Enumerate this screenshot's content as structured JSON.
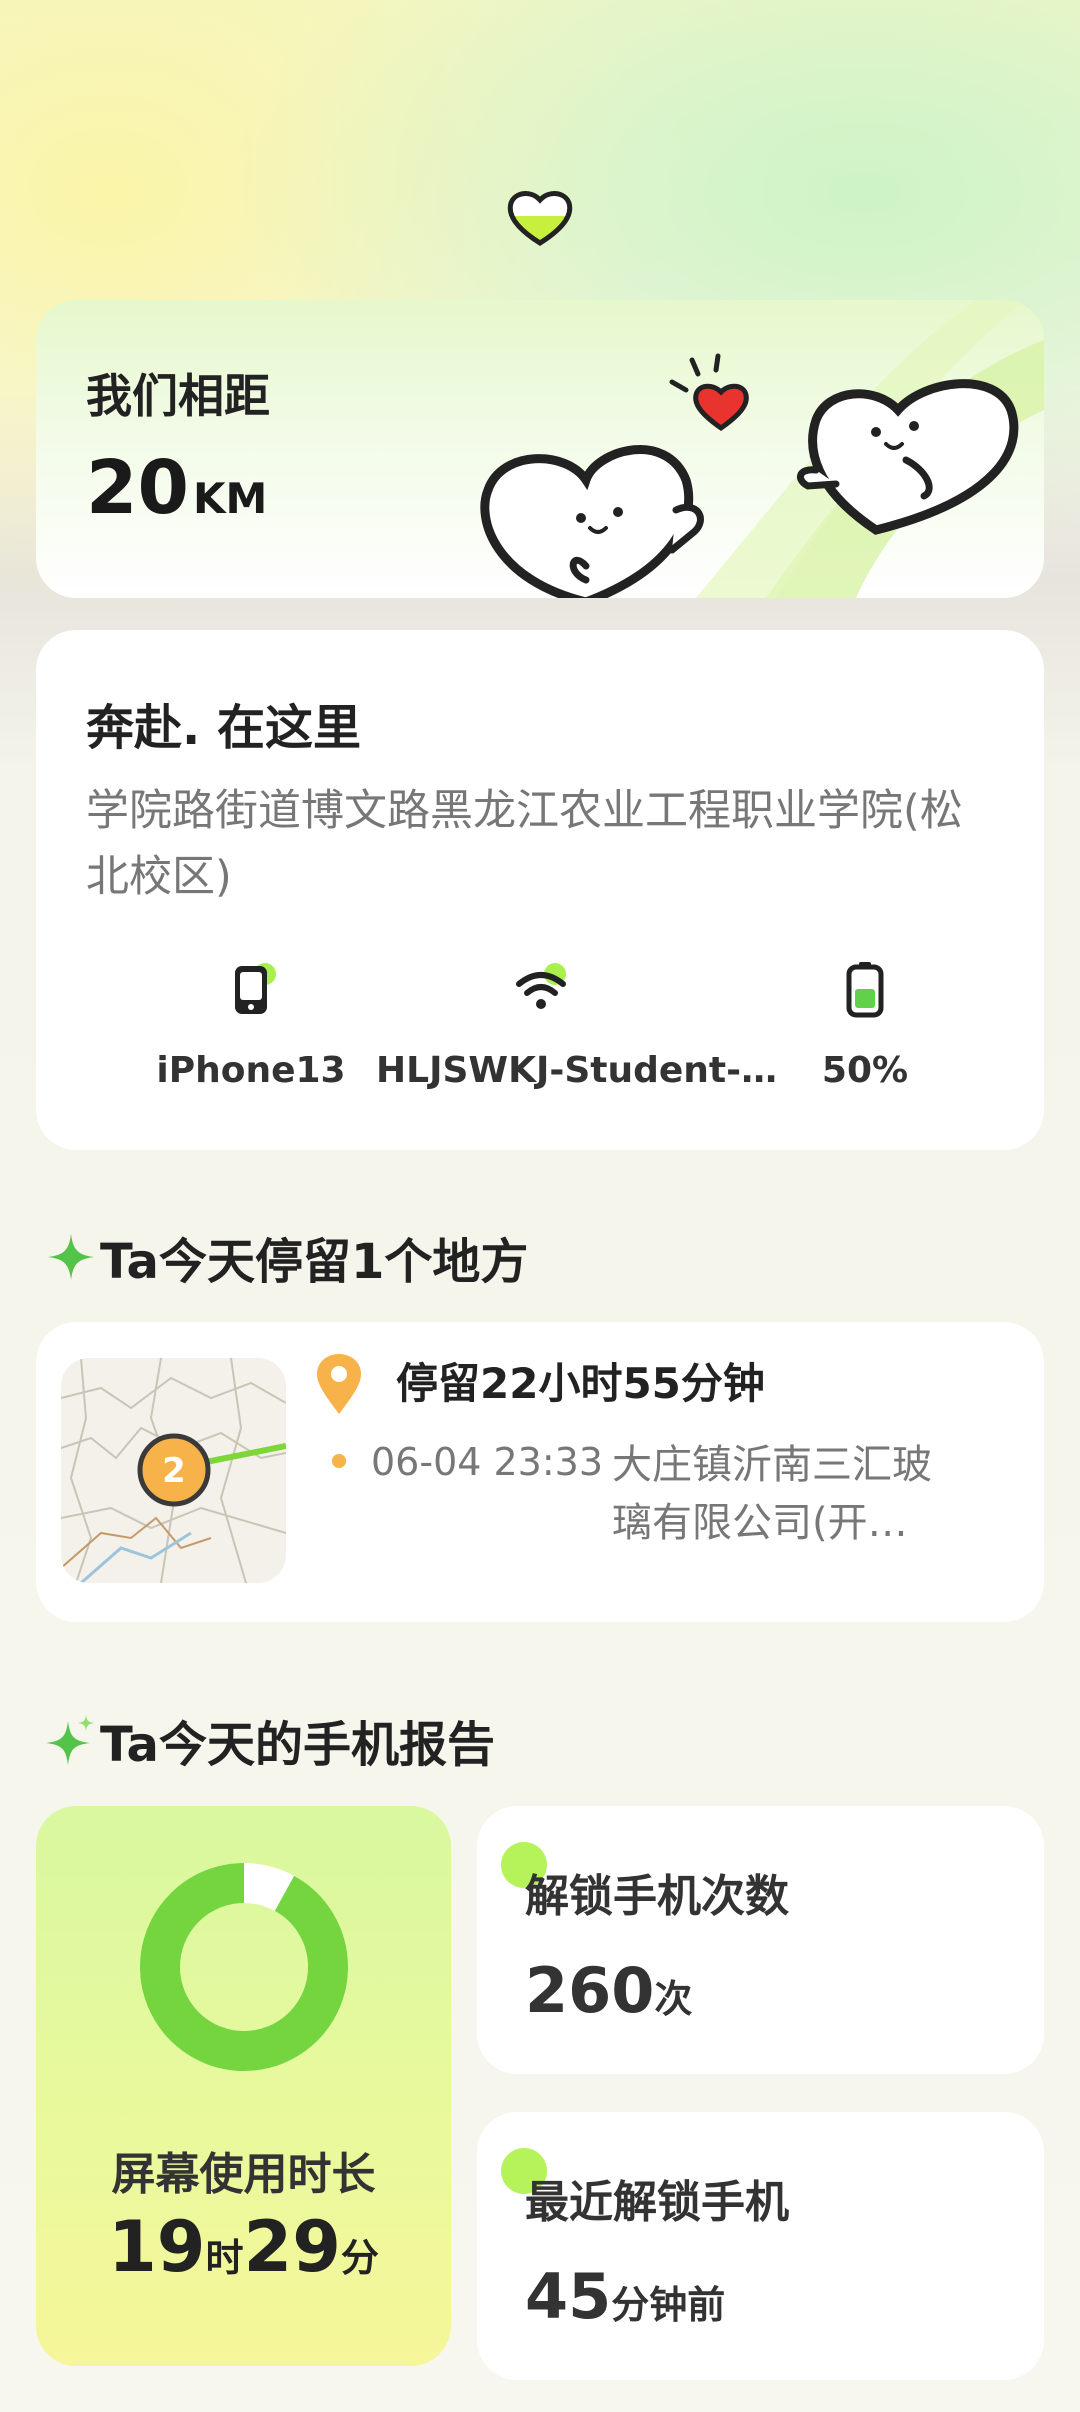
{
  "distance": {
    "label": "我们相距",
    "value": "20",
    "unit": "KM"
  },
  "location": {
    "title": "奔赴. 在这里",
    "address": "学院路街道博文路黑龙江农业工程职业学院(松北校区)",
    "device": {
      "label": "iPhone13",
      "icon": "phone-icon"
    },
    "wifi": {
      "label": "HLJSWKJ-Student-…",
      "icon": "wifi-icon"
    },
    "battery": {
      "label": "50%",
      "icon": "battery-icon",
      "level": 0.5
    }
  },
  "stays": {
    "heading": "Ta今天停留1个地方",
    "items": [
      {
        "map_marker": "2",
        "title": "停留22小时55分钟",
        "time": "06-04 23:33",
        "place": "大庄镇沂南三汇玻璃有限公司(开…"
      }
    ]
  },
  "report": {
    "heading": "Ta今天的手机报告",
    "screen_time": {
      "label": "屏幕使用时长",
      "hours": "19",
      "hours_unit": "时",
      "minutes": "29",
      "minutes_unit": "分",
      "ring_fraction": 0.92
    },
    "unlocks": {
      "label": "解锁手机次数",
      "value": "260",
      "unit": "次"
    },
    "last_unlock": {
      "label": "最近解锁手机",
      "value": "45",
      "unit": "分钟前"
    }
  },
  "colors": {
    "accent_green": "#7ed63a",
    "pin_orange": "#f7b24a",
    "heart_red": "#e8332f"
  }
}
